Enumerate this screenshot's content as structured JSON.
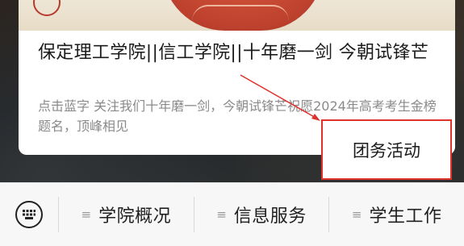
{
  "article": {
    "title": "保定理工学院||信工学院||十年磨一剑 今朝试锋芒",
    "description": "点击蓝字 关注我们十年磨一剑，今朝试锋芒祝愿2024年高考考生金榜题名，顶峰相见"
  },
  "popup_menu": {
    "item_label": "团务活动"
  },
  "bottom_menu": {
    "keyboard_icon": "keyboard-icon",
    "items": [
      {
        "icon": "menu-lines-icon",
        "label": "学院概况"
      },
      {
        "icon": "menu-lines-icon",
        "label": "信息服务"
      },
      {
        "icon": "menu-lines-icon",
        "label": "学生工作"
      }
    ]
  },
  "colors": {
    "annotation_red": "#e0312b",
    "banner_red": "#c0432f"
  }
}
